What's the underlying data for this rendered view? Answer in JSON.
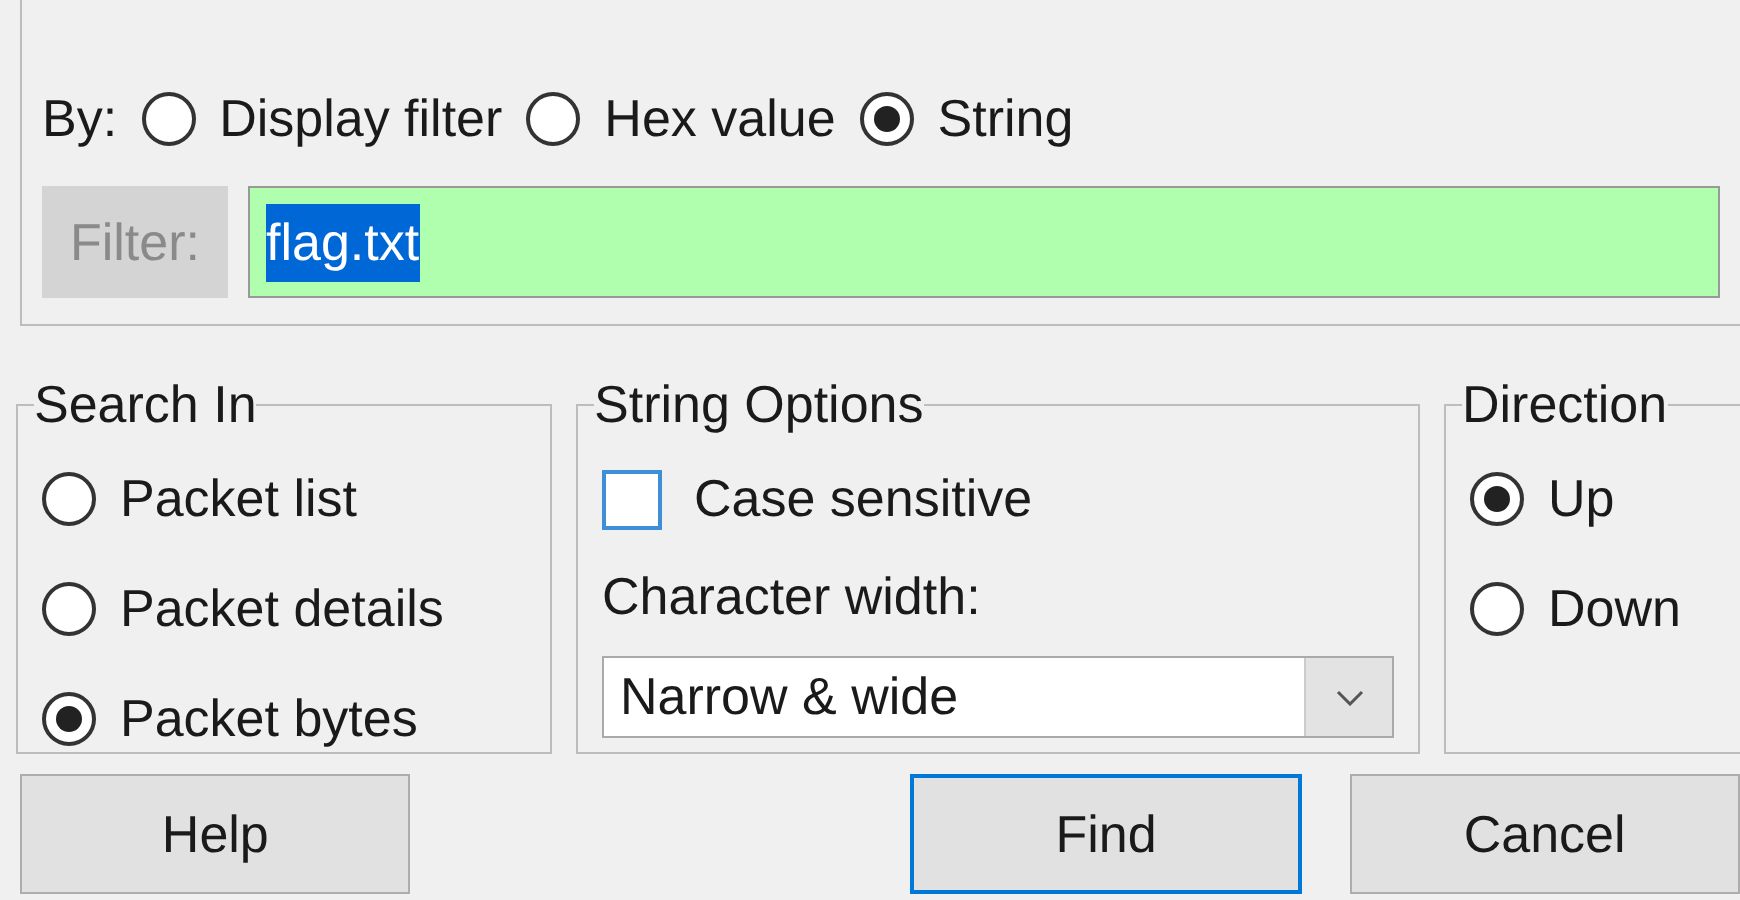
{
  "find_by": {
    "label": "By:",
    "options": [
      {
        "label": "Display filter",
        "selected": false
      },
      {
        "label": "Hex value",
        "selected": false
      },
      {
        "label": "String",
        "selected": true
      }
    ]
  },
  "filter": {
    "label": "Filter:",
    "value": "flag.txt",
    "valid": true,
    "text_selected": true
  },
  "search_in": {
    "title": "Search In",
    "options": [
      {
        "label": "Packet list",
        "selected": false
      },
      {
        "label": "Packet details",
        "selected": false
      },
      {
        "label": "Packet bytes",
        "selected": true
      }
    ]
  },
  "string_options": {
    "title": "String Options",
    "case_sensitive": {
      "label": "Case sensitive",
      "checked": false
    },
    "character_width": {
      "label": "Character width:",
      "value": "Narrow & wide"
    }
  },
  "direction": {
    "title": "Direction",
    "options": [
      {
        "label": "Up",
        "selected": true
      },
      {
        "label": "Down",
        "selected": false
      }
    ]
  },
  "buttons": [
    {
      "label": "Help",
      "default": false
    },
    {
      "label": "Find",
      "default": true
    },
    {
      "label": "Cancel",
      "default": false
    }
  ]
}
